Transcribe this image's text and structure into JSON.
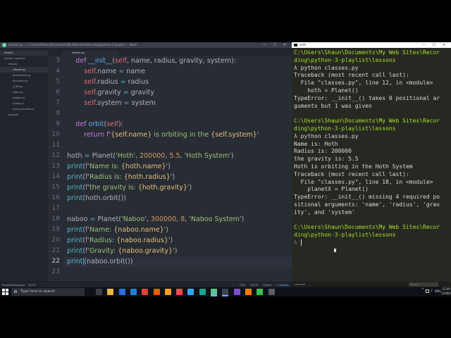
{
  "editor": {
    "title": "classes.py — C:\\Users\\Shaun\\Documents\\My Web Sites\\Recoding\\python-3-playlist — Atom",
    "window_controls": "— ☐ ✕",
    "tree_root": "Project",
    "tree": [
      {
        "label": "python-3-playlist",
        "indent": 1
      },
      {
        "label": "lessons",
        "indent": 2
      },
      {
        "label": "classes.py",
        "indent": 3,
        "selected": true
      },
      {
        "label": "dictionaries.py",
        "indent": 3
      },
      {
        "label": "functions.py",
        "indent": 3
      },
      {
        "label": "if_elif.py",
        "indent": 3
      },
      {
        "label": "loops.py",
        "indent": 3
      },
      {
        "label": "ranges.py",
        "indent": 3
      },
      {
        "label": "scope.py",
        "indent": 3
      },
      {
        "label": "string_formats.py",
        "indent": 3
      },
      {
        "label": "projects",
        "indent": 2
      }
    ],
    "tab": "classes.py",
    "line_numbers": [
      "3",
      "4",
      "5",
      "6",
      "7",
      "8",
      "9",
      "10",
      "11",
      "12",
      "13",
      "14",
      "15",
      "16",
      "17",
      "18",
      "19",
      "20",
      "21",
      "22",
      "23"
    ],
    "current_line": "22",
    "code": [
      [
        {
          "t": "    "
        },
        {
          "t": "def ",
          "c": "kw"
        },
        {
          "t": "__init__",
          "c": "fn"
        },
        {
          "t": "("
        },
        {
          "t": "self",
          "c": "sf"
        },
        {
          "t": ", name, radius, gravity, system):"
        }
      ],
      [
        {
          "t": "        "
        },
        {
          "t": "self",
          "c": "sf"
        },
        {
          "t": ".name "
        },
        {
          "t": "=",
          "c": "op"
        },
        {
          "t": " name"
        }
      ],
      [
        {
          "t": "        "
        },
        {
          "t": "self",
          "c": "sf"
        },
        {
          "t": ".radius "
        },
        {
          "t": "=",
          "c": "op"
        },
        {
          "t": " radius"
        }
      ],
      [
        {
          "t": "        "
        },
        {
          "t": "self",
          "c": "sf"
        },
        {
          "t": ".gravity "
        },
        {
          "t": "=",
          "c": "op"
        },
        {
          "t": " gravity"
        }
      ],
      [
        {
          "t": "        "
        },
        {
          "t": "self",
          "c": "sf"
        },
        {
          "t": ".system "
        },
        {
          "t": "=",
          "c": "op"
        },
        {
          "t": " system"
        }
      ],
      [],
      [
        {
          "t": "    "
        },
        {
          "t": "def ",
          "c": "kw"
        },
        {
          "t": "orbit",
          "c": "fn"
        },
        {
          "t": "("
        },
        {
          "t": "self",
          "c": "sf"
        },
        {
          "t": "):"
        }
      ],
      [
        {
          "t": "        "
        },
        {
          "t": "return ",
          "c": "kw"
        },
        {
          "t": "f",
          "c": "kw"
        },
        {
          "t": "'",
          "c": "st"
        },
        {
          "t": "{self.name}",
          "c": "bi"
        },
        {
          "t": " is orbiting in the ",
          "c": "st"
        },
        {
          "t": "{self.system}",
          "c": "bi"
        },
        {
          "t": "'",
          "c": "st"
        }
      ],
      [],
      [
        {
          "t": "hoth "
        },
        {
          "t": "=",
          "c": "op"
        },
        {
          "t": " Planet("
        },
        {
          "t": "'Hoth'",
          "c": "st"
        },
        {
          "t": ", "
        },
        {
          "t": "200000",
          "c": "nm"
        },
        {
          "t": ", "
        },
        {
          "t": "5.5",
          "c": "nm"
        },
        {
          "t": ", "
        },
        {
          "t": "'Hoth System'",
          "c": "st"
        },
        {
          "t": ")"
        }
      ],
      [
        {
          "t": "print",
          "c": "op"
        },
        {
          "t": "("
        },
        {
          "t": "f",
          "c": "kw"
        },
        {
          "t": "'Name is: ",
          "c": "st"
        },
        {
          "t": "{hoth.name}",
          "c": "bi"
        },
        {
          "t": "'",
          "c": "st"
        },
        {
          "t": ")"
        }
      ],
      [
        {
          "t": "print",
          "c": "op"
        },
        {
          "t": "("
        },
        {
          "t": "f",
          "c": "kw"
        },
        {
          "t": "'Radius is: ",
          "c": "st"
        },
        {
          "t": "{hoth.radius}",
          "c": "bi"
        },
        {
          "t": "'",
          "c": "st"
        },
        {
          "t": ")"
        }
      ],
      [
        {
          "t": "print",
          "c": "op"
        },
        {
          "t": "("
        },
        {
          "t": "f",
          "c": "kw"
        },
        {
          "t": "'the gravity is: ",
          "c": "st"
        },
        {
          "t": "{hoth.gravity}",
          "c": "bi"
        },
        {
          "t": "'",
          "c": "st"
        },
        {
          "t": ")"
        }
      ],
      [
        {
          "t": "print",
          "c": "op"
        },
        {
          "t": "(hoth.orbit())"
        }
      ],
      [],
      [
        {
          "t": "naboo "
        },
        {
          "t": "=",
          "c": "op"
        },
        {
          "t": " Planet("
        },
        {
          "t": "'Naboo'",
          "c": "st"
        },
        {
          "t": ", "
        },
        {
          "t": "300000",
          "c": "nm"
        },
        {
          "t": ", "
        },
        {
          "t": "8",
          "c": "nm"
        },
        {
          "t": ", "
        },
        {
          "t": "'Naboo System'",
          "c": "st"
        },
        {
          "t": ")"
        }
      ],
      [
        {
          "t": "print",
          "c": "op"
        },
        {
          "t": "("
        },
        {
          "t": "f",
          "c": "kw"
        },
        {
          "t": "'Name: ",
          "c": "st"
        },
        {
          "t": "{naboo.name}",
          "c": "bi"
        },
        {
          "t": "'",
          "c": "st"
        },
        {
          "t": ")"
        }
      ],
      [
        {
          "t": "print",
          "c": "op"
        },
        {
          "t": "("
        },
        {
          "t": "f",
          "c": "kw"
        },
        {
          "t": "'Radius: ",
          "c": "st"
        },
        {
          "t": "{naboo.radius}",
          "c": "bi"
        },
        {
          "t": "'",
          "c": "st"
        },
        {
          "t": ")"
        }
      ],
      [
        {
          "t": "print",
          "c": "op"
        },
        {
          "t": "("
        },
        {
          "t": "f",
          "c": "kw"
        },
        {
          "t": "'Gravity: ",
          "c": "st"
        },
        {
          "t": "{naboo.gravity}",
          "c": "bi"
        },
        {
          "t": "'",
          "c": "st"
        },
        {
          "t": ")"
        }
      ],
      [
        {
          "t": "print",
          "c": "op"
        },
        {
          "cursor": true
        },
        {
          "t": "(naboo.orbit())"
        }
      ],
      []
    ],
    "status": {
      "path": "lessons\\classes.py",
      "position": "22:20",
      "line_ending": "CRLF",
      "encoding": "UTF-8",
      "grammar": "Python",
      "updates": "3 updates"
    }
  },
  "cmd": {
    "title": "cmd",
    "window_controls": "— ☐ ✕",
    "lines": [
      {
        "t": "C:\\Users\\Shaun\\Documents\\My Web Sites\\Recor",
        "k": "path"
      },
      {
        "t": "ding\\python-3-playlist\\lessons",
        "k": "path"
      },
      {
        "t": "λ python classes.py",
        "k": ""
      },
      {
        "t": "Traceback (most recent call last):",
        "k": ""
      },
      {
        "t": "  File \"classes.py\", line 12, in <module>",
        "k": ""
      },
      {
        "t": "    hoth = Planet()",
        "k": ""
      },
      {
        "t": "TypeError: __init__() takes 0 positional ar",
        "k": ""
      },
      {
        "t": "guments but 1 was given",
        "k": ""
      },
      {
        "t": "",
        "k": ""
      },
      {
        "t": "C:\\Users\\Shaun\\Documents\\My Web Sites\\Recor",
        "k": "path"
      },
      {
        "t": "ding\\python-3-playlist\\lessons",
        "k": "path"
      },
      {
        "t": "λ python classes.py",
        "k": ""
      },
      {
        "t": "Name is: Hoth",
        "k": ""
      },
      {
        "t": "Radius is: 200000",
        "k": ""
      },
      {
        "t": "the gravity is: 5.5",
        "k": ""
      },
      {
        "t": "Hoth is orbiting in the Hoth System",
        "k": ""
      },
      {
        "t": "Traceback (most recent call last):",
        "k": ""
      },
      {
        "t": "  File \"classes.py\", line 18, in <module>",
        "k": ""
      },
      {
        "t": "    planetX = Planet()",
        "k": ""
      },
      {
        "t": "TypeError: __init__() missing 4 required po",
        "k": ""
      },
      {
        "t": "sitional arguments: 'name', 'radius', 'grav",
        "k": ""
      },
      {
        "t": "ity', and 'system'",
        "k": ""
      },
      {
        "t": "",
        "k": ""
      },
      {
        "t": "C:\\Users\\Shaun\\Documents\\My Web Sites\\Recor",
        "k": "path"
      },
      {
        "t": "ding\\python-3-playlist\\lessons",
        "k": "path"
      },
      {
        "t": "λ ",
        "k": "prompt"
      }
    ],
    "status_left": "cmd.exe",
    "search_placeholder": "Search"
  },
  "taskbar": {
    "search_label": "Type here to search",
    "apps": [
      {
        "name": "task-view-icon",
        "color": "#3b3f47"
      },
      {
        "name": "file-explorer-icon",
        "color": "#e8b84a"
      },
      {
        "name": "store-icon",
        "color": "#2a6fdb"
      },
      {
        "name": "edge-icon",
        "color": "#1f7fd8"
      },
      {
        "name": "chrome-icon",
        "color": "#db4437"
      },
      {
        "name": "firefox-icon",
        "color": "#e66000"
      },
      {
        "name": "sublime-icon",
        "color": "#f29b2a"
      },
      {
        "name": "vivaldi-icon",
        "color": "#e84c4c"
      },
      {
        "name": "photoshop-icon",
        "color": "#31a8ff"
      },
      {
        "name": "gitkraken-icon",
        "color": "#1aa38f"
      },
      {
        "name": "atom-icon",
        "color": "#58c48b",
        "active": true
      },
      {
        "name": "cmder-icon",
        "color": "#3c4557",
        "active": true
      },
      {
        "name": "visual-studio-icon",
        "color": "#7a4fd3"
      },
      {
        "name": "illustrator-icon",
        "color": "#ff7c00"
      },
      {
        "name": "camtasia-icon",
        "color": "#3cbf4e"
      },
      {
        "name": "app-icon",
        "color": "#5a5f66"
      }
    ],
    "tray_arrow": "^",
    "tray_lang": "ENG",
    "clock_time": "12:09",
    "clock_date": "12/06/2017"
  }
}
